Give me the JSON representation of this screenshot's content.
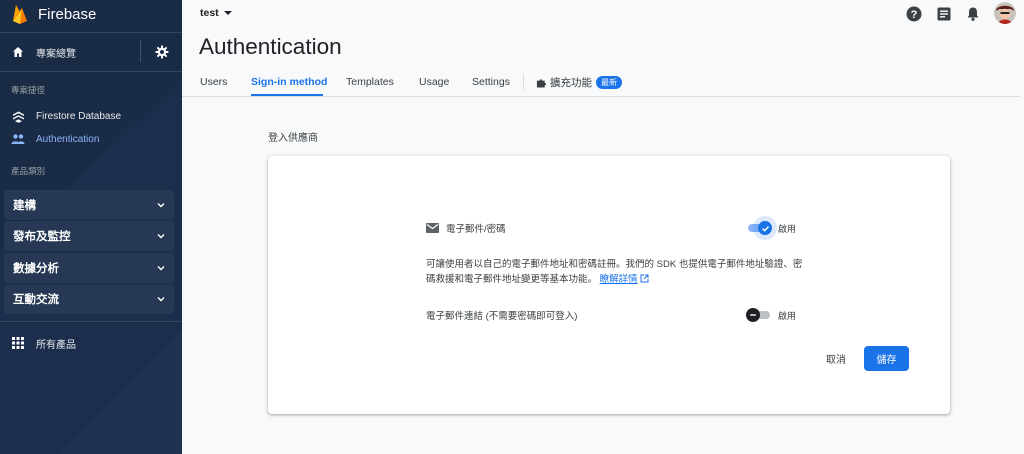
{
  "sidebar": {
    "brand": "Firebase",
    "overview": "專案總覽",
    "shortcuts_heading": "專案捷徑",
    "shortcuts": [
      {
        "label": "Firestore Database"
      },
      {
        "label": "Authentication"
      }
    ],
    "categories_heading": "產品類別",
    "categories": [
      {
        "label": "建構"
      },
      {
        "label": "發布及監控"
      },
      {
        "label": "數據分析"
      },
      {
        "label": "互動交流"
      }
    ],
    "all_products": "所有產品"
  },
  "header": {
    "project": "test",
    "title": "Authentication"
  },
  "tabs": [
    {
      "label": "Users"
    },
    {
      "label": "Sign-in method"
    },
    {
      "label": "Templates"
    },
    {
      "label": "Usage"
    },
    {
      "label": "Settings"
    }
  ],
  "extensions": {
    "label": "擴充功能",
    "badge": "最新"
  },
  "providers": {
    "heading": "登入供應商",
    "email_password": {
      "name": "電子郵件/密碼",
      "toggle_label": "啟用",
      "enabled": true
    },
    "description": "可讓使用者以自己的電子郵件地址和密碼註冊。我們的 SDK 也提供電子郵件地址驗證、密碼救援和電子郵件地址變更等基本功能。",
    "learn_more": "瞭解詳情",
    "email_link": {
      "name": "電子郵件連結 (不需要密碼即可登入)",
      "toggle_label": "啟用",
      "enabled": false
    },
    "cancel": "取消",
    "save": "儲存"
  },
  "colors": {
    "sidebar_bg": "#1a2b46",
    "accent": "#1a73e8"
  }
}
